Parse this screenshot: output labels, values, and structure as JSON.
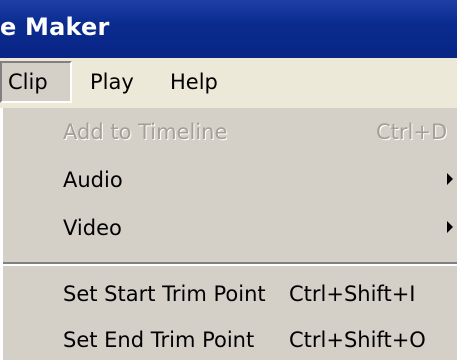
{
  "window": {
    "title": "e Maker"
  },
  "menubar": {
    "items": [
      {
        "label": "Clip",
        "active": true
      },
      {
        "label": "Play"
      },
      {
        "label": "Help"
      }
    ]
  },
  "dropdown": {
    "items": [
      {
        "label": "Add to Timeline",
        "shortcut": "Ctrl+D",
        "enabled": false
      },
      {
        "label": "Audio",
        "submenu": true,
        "enabled": true
      },
      {
        "label": "Video",
        "submenu": true,
        "enabled": true
      },
      {
        "separator": true
      },
      {
        "label": "Set Start Trim Point",
        "shortcut": "Ctrl+Shift+I",
        "enabled": true
      },
      {
        "label": "Set End Trim Point",
        "shortcut": "Ctrl+Shift+O",
        "enabled": true
      }
    ]
  },
  "icons": {
    "submenu_arrow": "submenu-arrow-icon"
  },
  "colors": {
    "titlebar": "#0a2b8f",
    "menu_background": "#d4d0c8",
    "menubar_background": "#ece9d8",
    "disabled_text": "#a4a096"
  }
}
